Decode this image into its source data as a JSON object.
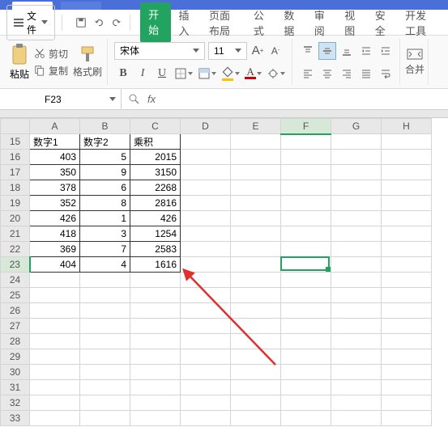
{
  "menu": {
    "file_label": "文件"
  },
  "ribbon_tabs": {
    "start": "开始",
    "insert": "插入",
    "page_layout": "页面布局",
    "formula": "公式",
    "data": "数据",
    "review": "审阅",
    "view": "视图",
    "security": "安全",
    "dev": "开发工具"
  },
  "clipboard": {
    "paste": "粘贴",
    "cut": "剪切",
    "copy": "复制",
    "format_painter": "格式刷"
  },
  "font": {
    "name": "宋体",
    "size": "11"
  },
  "merge": {
    "label": "合并"
  },
  "name_box": {
    "value": "F23"
  },
  "sheet": {
    "col_headers": [
      "A",
      "B",
      "C",
      "D",
      "E",
      "F",
      "G",
      "H"
    ],
    "row_start": 15,
    "row_count": 19,
    "headers": {
      "a": "数字1",
      "b": "数字2",
      "c": "乘积"
    },
    "rows": [
      {
        "a": 403,
        "b": 5,
        "c": 2015
      },
      {
        "a": 350,
        "b": 9,
        "c": 3150
      },
      {
        "a": 378,
        "b": 6,
        "c": 2268
      },
      {
        "a": 352,
        "b": 8,
        "c": 2816
      },
      {
        "a": 426,
        "b": 1,
        "c": 426
      },
      {
        "a": 418,
        "b": 3,
        "c": 1254
      },
      {
        "a": 369,
        "b": 7,
        "c": 2583
      },
      {
        "a": 404,
        "b": 4,
        "c": 1616
      }
    ],
    "active_cell": "F23"
  }
}
